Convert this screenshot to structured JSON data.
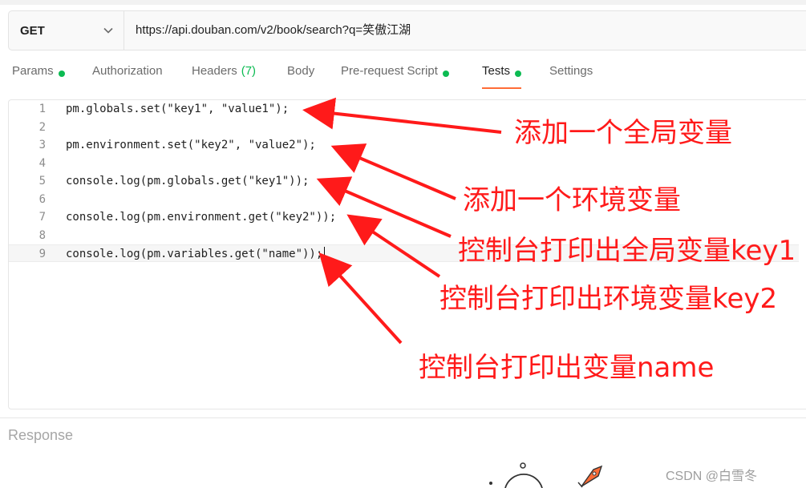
{
  "request": {
    "method": "GET",
    "url": "https://api.douban.com/v2/book/search?q=笑傲江湖"
  },
  "tabs": [
    {
      "label": "Params",
      "dot": true
    },
    {
      "label": "Authorization"
    },
    {
      "label": "Headers",
      "count": "(7)"
    },
    {
      "label": "Body"
    },
    {
      "label": "Pre-request Script",
      "dot": true
    },
    {
      "label": "Tests",
      "dot": true,
      "active": true
    },
    {
      "label": "Settings"
    }
  ],
  "editor": {
    "lines": [
      {
        "n": "1",
        "code": "pm.globals.set(\"key1\", \"value1\");"
      },
      {
        "n": "2",
        "code": ""
      },
      {
        "n": "3",
        "code": "pm.environment.set(\"key2\", \"value2\");"
      },
      {
        "n": "4",
        "code": ""
      },
      {
        "n": "5",
        "code": "console.log(pm.globals.get(\"key1\"));"
      },
      {
        "n": "6",
        "code": ""
      },
      {
        "n": "7",
        "code": "console.log(pm.environment.get(\"key2\"));"
      },
      {
        "n": "8",
        "code": ""
      },
      {
        "n": "9",
        "code": "console.log(pm.variables.get(\"name\"));"
      }
    ]
  },
  "annotations": [
    "添加一个全局变量",
    "添加一个环境变量",
    "控制台打印出全局变量key1",
    "控制台打印出环境变量key2",
    "控制台打印出变量name"
  ],
  "response": {
    "label": "Response"
  },
  "watermark": "CSDN @白雪冬",
  "colors": {
    "accent": "#ff6c37",
    "dot": "#0cbb52",
    "annotation": "#ff1a1a"
  }
}
